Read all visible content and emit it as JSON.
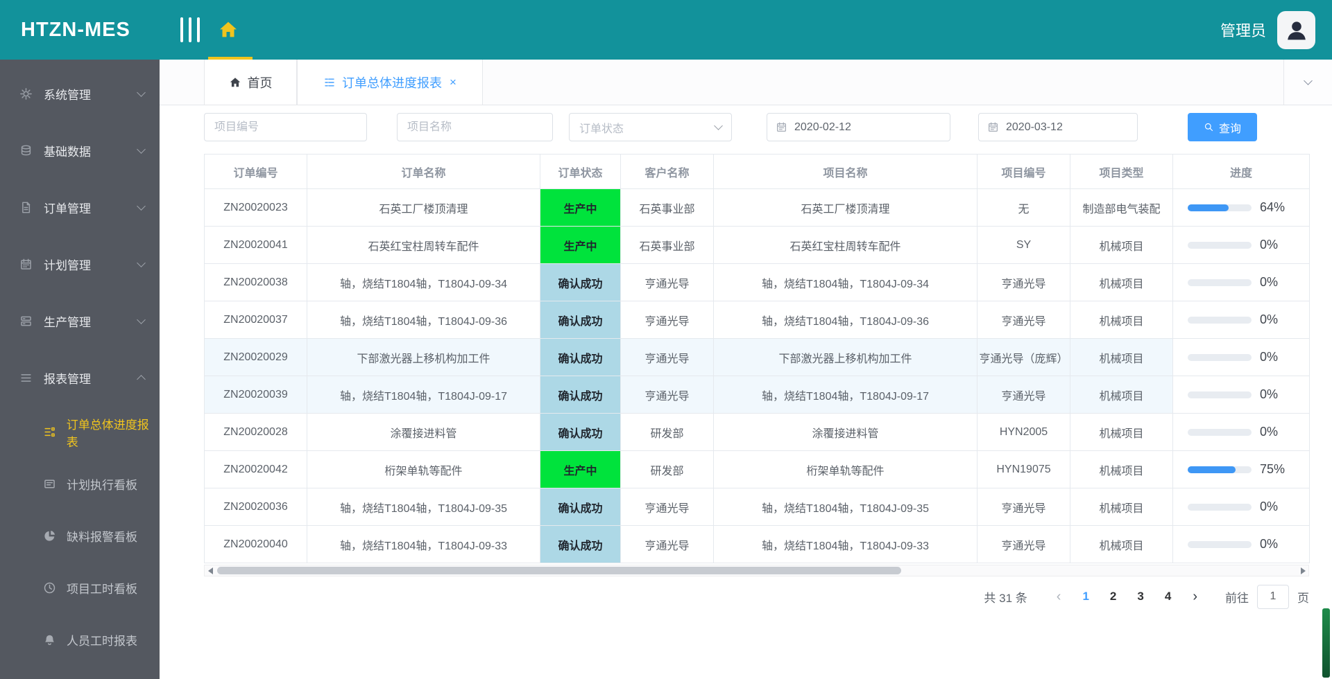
{
  "colors": {
    "teal": "#12929B",
    "gold": "#F0C41E",
    "accent_blue": "#409EFF",
    "status_green": "#00E33C",
    "status_blue": "#ADD8E6",
    "progress_blue": "#3E97F5"
  },
  "header": {
    "logo": "HTZN-MES",
    "user": "管理员"
  },
  "sidebar": {
    "items": [
      {
        "icon": "gear",
        "label": "系统管理",
        "expanded": false
      },
      {
        "icon": "database",
        "label": "基础数据",
        "expanded": false
      },
      {
        "icon": "document",
        "label": "订单管理",
        "expanded": false
      },
      {
        "icon": "calendar",
        "label": "计划管理",
        "expanded": false
      },
      {
        "icon": "server",
        "label": "生产管理",
        "expanded": false
      },
      {
        "icon": "menu",
        "label": "报表管理",
        "expanded": true,
        "children": [
          {
            "icon": "orderlist",
            "label": "订单总体进度报表",
            "active": true
          },
          {
            "icon": "board",
            "label": "计划执行看板",
            "active": false
          },
          {
            "icon": "pie",
            "label": "缺料报警看板",
            "active": false
          },
          {
            "icon": "clock",
            "label": "项目工时看板",
            "active": false
          },
          {
            "icon": "bell",
            "label": "人员工时报表",
            "active": false
          }
        ]
      }
    ]
  },
  "tabs": [
    {
      "icon": "home",
      "label": "首页",
      "active": false
    },
    {
      "icon": "listicon",
      "label": "订单总体进度报表",
      "close": "×",
      "active": true
    }
  ],
  "filters": {
    "project_no_placeholder": "项目编号",
    "project_name_placeholder": "项目名称",
    "order_status_placeholder": "订单状态",
    "date_from": "2020-02-12",
    "date_to": "2020-03-12",
    "search_label": "查询"
  },
  "table": {
    "columns": [
      "订单编号",
      "订单名称",
      "订单状态",
      "客户名称",
      "项目名称",
      "项目编号",
      "项目类型",
      "进度"
    ],
    "rows": [
      {
        "order_no": "ZN20020023",
        "order_name": "石英工厂楼顶清理",
        "status": "生产中",
        "customer": "石英事业部",
        "project_name": "石英工厂楼顶清理",
        "project_no": "无",
        "project_type": "制造部电气装配",
        "progress": 64,
        "progress_label": "64%",
        "striped": false
      },
      {
        "order_no": "ZN20020041",
        "order_name": "石英红宝柱周转车配件",
        "status": "生产中",
        "customer": "石英事业部",
        "project_name": "石英红宝柱周转车配件",
        "project_no": "SY",
        "project_type": "机械项目",
        "progress": 0,
        "progress_label": "0%",
        "striped": false
      },
      {
        "order_no": "ZN20020038",
        "order_name": "轴，烧结T1804轴，T1804J-09-34",
        "status": "确认成功",
        "customer": "亨通光导",
        "project_name": "轴，烧结T1804轴，T1804J-09-34",
        "project_no": "亨通光导",
        "project_type": "机械项目",
        "progress": 0,
        "progress_label": "0%",
        "striped": false
      },
      {
        "order_no": "ZN20020037",
        "order_name": "轴，烧结T1804轴，T1804J-09-36",
        "status": "确认成功",
        "customer": "亨通光导",
        "project_name": "轴，烧结T1804轴，T1804J-09-36",
        "project_no": "亨通光导",
        "project_type": "机械项目",
        "progress": 0,
        "progress_label": "0%",
        "striped": false
      },
      {
        "order_no": "ZN20020029",
        "order_name": "下部激光器上移机构加工件",
        "status": "确认成功",
        "customer": "亨通光导",
        "project_name": "下部激光器上移机构加工件",
        "project_no": "亨通光导（庞辉）",
        "project_type": "机械项目",
        "progress": 0,
        "progress_label": "0%",
        "striped": true
      },
      {
        "order_no": "ZN20020039",
        "order_name": "轴，烧结T1804轴，T1804J-09-17",
        "status": "确认成功",
        "customer": "亨通光导",
        "project_name": "轴，烧结T1804轴，T1804J-09-17",
        "project_no": "亨通光导",
        "project_type": "机械项目",
        "progress": 0,
        "progress_label": "0%",
        "striped": true
      },
      {
        "order_no": "ZN20020028",
        "order_name": "涂覆接进料管",
        "status": "确认成功",
        "customer": "研发部",
        "project_name": "涂覆接进料管",
        "project_no": "HYN2005",
        "project_type": "机械项目",
        "progress": 0,
        "progress_label": "0%",
        "striped": false
      },
      {
        "order_no": "ZN20020042",
        "order_name": "桁架单轨等配件",
        "status": "生产中",
        "customer": "研发部",
        "project_name": "桁架单轨等配件",
        "project_no": "HYN19075",
        "project_type": "机械项目",
        "progress": 75,
        "progress_label": "75%",
        "striped": false
      },
      {
        "order_no": "ZN20020036",
        "order_name": "轴，烧结T1804轴，T1804J-09-35",
        "status": "确认成功",
        "customer": "亨通光导",
        "project_name": "轴，烧结T1804轴，T1804J-09-35",
        "project_no": "亨通光导",
        "project_type": "机械项目",
        "progress": 0,
        "progress_label": "0%",
        "striped": false
      },
      {
        "order_no": "ZN20020040",
        "order_name": "轴，烧结T1804轴，T1804J-09-33",
        "status": "确认成功",
        "customer": "亨通光导",
        "project_name": "轴，烧结T1804轴，T1804J-09-33",
        "project_no": "亨通光导",
        "project_type": "机械项目",
        "progress": 0,
        "progress_label": "0%",
        "striped": false
      }
    ]
  },
  "pagination": {
    "total": "共 31 条",
    "prev": "‹",
    "pages": [
      "1",
      "2",
      "3",
      "4"
    ],
    "active_page": "1",
    "next": "›",
    "goto_label": "前往",
    "goto_value": "1",
    "unit_label": "页"
  }
}
